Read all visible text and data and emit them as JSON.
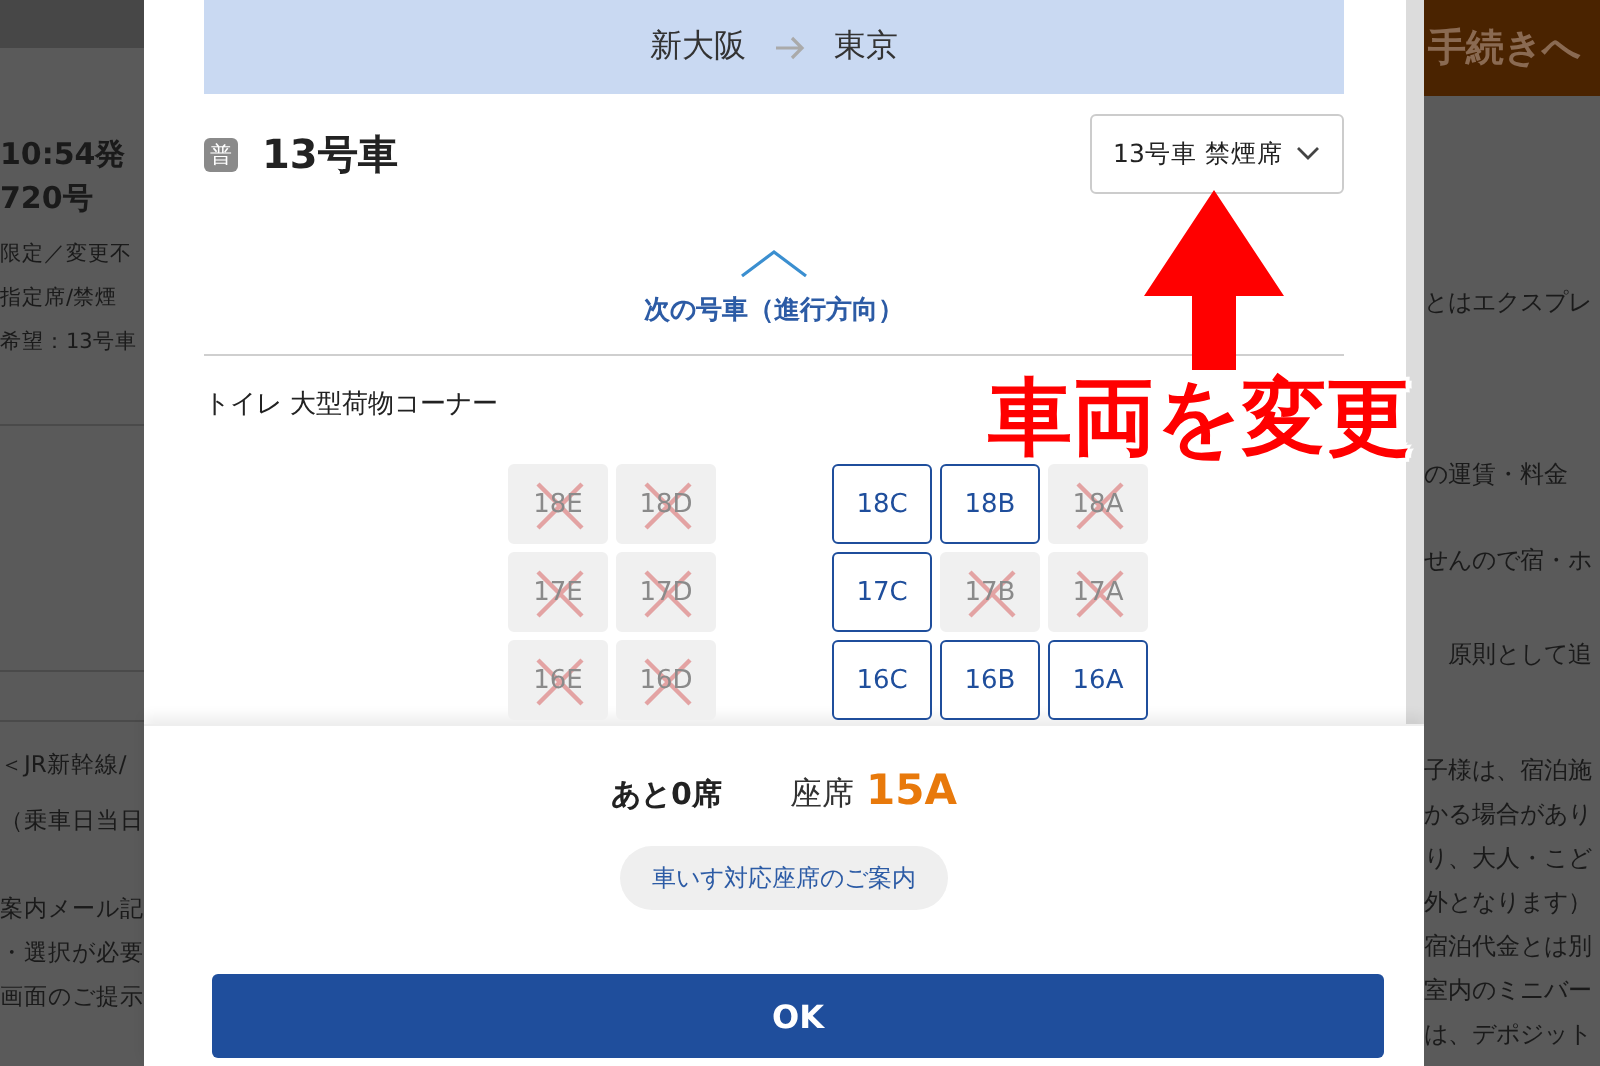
{
  "background": {
    "left_top": [
      {
        "text": "10:54発",
        "kind": "heading"
      },
      {
        "text": "720号",
        "kind": "heading"
      },
      {
        "text": "限定／変更不",
        "kind": "body"
      },
      {
        "text": "指定席/禁煙",
        "kind": "body"
      },
      {
        "text": "希望：13号車",
        "kind": "body"
      }
    ],
    "left_bottom": [
      "＜JR新幹線/",
      "（乗車日当日",
      "案内メール記",
      "・選択が必要",
      "画面のご提示"
    ],
    "right_header": "手続きへ",
    "right_groups": [
      [
        "とはエクスプレ"
      ],
      [
        "の運賃・料金"
      ],
      [
        "せんので宿・ホ"
      ],
      [
        "原則として追"
      ],
      [
        "子様は、宿泊施",
        "かる場合があり",
        "り、大人・こど",
        "外となります）",
        "宿泊代金とは別",
        "室内のミニバー",
        "は、デポジット"
      ]
    ]
  },
  "dialog": {
    "route": {
      "from": "新大阪",
      "to": "東京"
    },
    "car": {
      "badge": "普",
      "title": "13号車"
    },
    "car_select": {
      "value": "13号車 禁煙席"
    },
    "next_car": "次の号車（進行方向）",
    "facility": "トイレ 大型荷物コーナー",
    "seat_rows": [
      {
        "left": [
          {
            "label": "18E",
            "available": false
          },
          {
            "label": "18D",
            "available": false
          }
        ],
        "right": [
          {
            "label": "18C",
            "available": true
          },
          {
            "label": "18B",
            "available": true
          },
          {
            "label": "18A",
            "available": false
          }
        ]
      },
      {
        "left": [
          {
            "label": "17E",
            "available": false
          },
          {
            "label": "17D",
            "available": false
          }
        ],
        "right": [
          {
            "label": "17C",
            "available": true
          },
          {
            "label": "17B",
            "available": false
          },
          {
            "label": "17A",
            "available": false
          }
        ]
      },
      {
        "left": [
          {
            "label": "16E",
            "available": false
          },
          {
            "label": "16D",
            "available": false
          }
        ],
        "right": [
          {
            "label": "16C",
            "available": true
          },
          {
            "label": "16B",
            "available": true
          },
          {
            "label": "16A",
            "available": true
          }
        ]
      }
    ],
    "remaining": "あと0席",
    "seat_label": "座席",
    "seat_value": "15A",
    "wheelchair_link": "車いす対応座席のご案内",
    "ok_button": "OK"
  },
  "annotation": {
    "text": "車両を変更"
  }
}
